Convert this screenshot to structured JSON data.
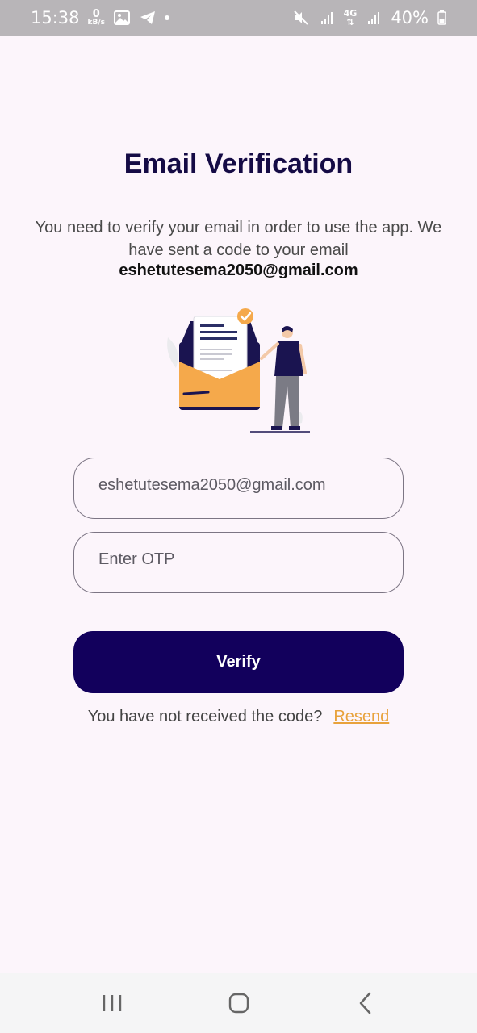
{
  "status_bar": {
    "time": "15:38",
    "data_speed_value": "0",
    "data_speed_unit": "kB/s",
    "network_type": "4G",
    "battery": "40%"
  },
  "page": {
    "title": "Email Verification",
    "description": "You need to verify your email in order to use the app. We have sent a code to your email",
    "email": "eshetutesema2050@gmail.com"
  },
  "form": {
    "email_value": "eshetutesema2050@gmail.com",
    "otp_placeholder": "Enter OTP",
    "verify_label": "Verify",
    "resend_prompt": "You have not received the code?",
    "resend_link": "Resend"
  },
  "colors": {
    "primary": "#12005c",
    "accent": "#e8a23c",
    "background": "#fcf5fb"
  },
  "icons": [
    "image-icon",
    "telegram-icon",
    "mute-icon",
    "signal-icon",
    "battery-icon",
    "recents-icon",
    "home-icon",
    "back-icon"
  ]
}
